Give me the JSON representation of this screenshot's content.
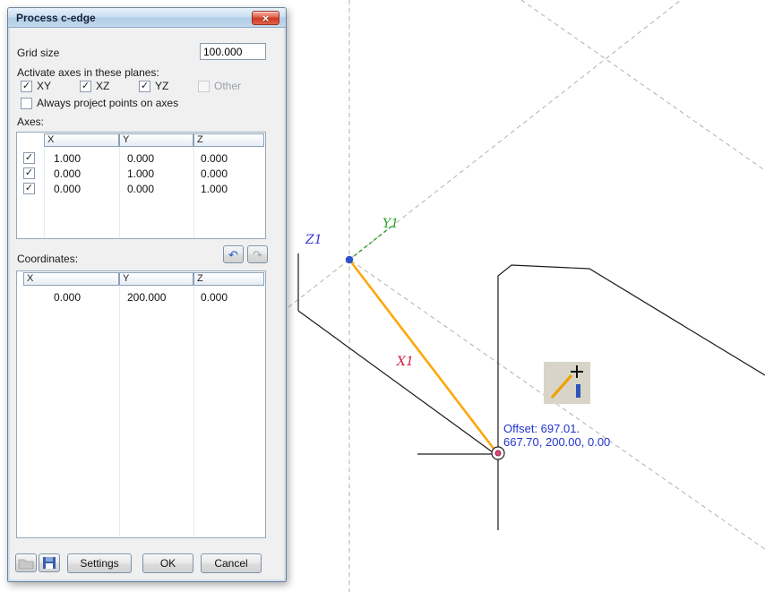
{
  "dialog": {
    "title": "Process c-edge",
    "grid_size": {
      "label": "Grid size",
      "value": "100.000"
    },
    "planes": {
      "label": "Activate axes in these planes:",
      "options": [
        {
          "label": "XY",
          "checked": true,
          "enabled": true
        },
        {
          "label": "XZ",
          "checked": true,
          "enabled": true
        },
        {
          "label": "YZ",
          "checked": true,
          "enabled": true
        },
        {
          "label": "Other",
          "checked": false,
          "enabled": false
        }
      ]
    },
    "project_points": {
      "label": "Always project points on axes",
      "checked": false
    },
    "axes": {
      "label": "Axes:",
      "columns": [
        "X",
        "Y",
        "Z"
      ],
      "rows": [
        {
          "checked": true,
          "x": "1.000",
          "y": "0.000",
          "z": "0.000"
        },
        {
          "checked": true,
          "x": "0.000",
          "y": "1.000",
          "z": "0.000"
        },
        {
          "checked": true,
          "x": "0.000",
          "y": "0.000",
          "z": "1.000"
        }
      ]
    },
    "coordinates": {
      "label": "Coordinates:",
      "columns": [
        "X",
        "Y",
        "Z"
      ],
      "rows": [
        {
          "x": "0.000",
          "y": "200.000",
          "z": "0.000"
        }
      ]
    },
    "buttons": {
      "settings": "Settings",
      "ok": "OK",
      "cancel": "Cancel"
    }
  },
  "icons": {
    "close": "×",
    "undo": "↶",
    "redo": "↷",
    "check": "✓"
  },
  "viewport": {
    "axis_labels": {
      "x": "X1",
      "y": "Y1",
      "z": "Z1"
    },
    "offset": {
      "line1": "Offset: 697.01.",
      "line2": "667.70, 200.00, 0.00"
    },
    "colors": {
      "x_label": "#cc2244",
      "y_label": "#27a22b",
      "z_label": "#3333cc",
      "highlight_edge": "#ffa60a",
      "annotation_text": "#2233cc",
      "grid_dashed": "#b5b1a5",
      "origin_point": "#2a52cc",
      "snap_marker": "#e0457b"
    }
  }
}
